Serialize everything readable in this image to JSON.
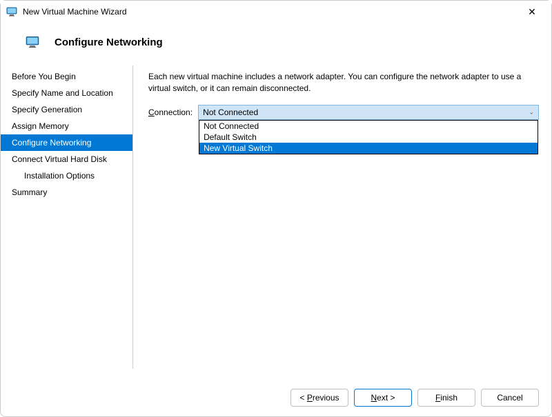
{
  "window": {
    "title": "New Virtual Machine Wizard",
    "close_glyph": "✕"
  },
  "header": {
    "title": "Configure Networking"
  },
  "sidebar": {
    "items": [
      {
        "label": "Before You Begin",
        "selected": false,
        "indent": false
      },
      {
        "label": "Specify Name and Location",
        "selected": false,
        "indent": false
      },
      {
        "label": "Specify Generation",
        "selected": false,
        "indent": false
      },
      {
        "label": "Assign Memory",
        "selected": false,
        "indent": false
      },
      {
        "label": "Configure Networking",
        "selected": true,
        "indent": false
      },
      {
        "label": "Connect Virtual Hard Disk",
        "selected": false,
        "indent": false
      },
      {
        "label": "Installation Options",
        "selected": false,
        "indent": true
      },
      {
        "label": "Summary",
        "selected": false,
        "indent": false
      }
    ]
  },
  "main": {
    "description": "Each new virtual machine includes a network adapter. You can configure the network adapter to use a virtual switch, or it can remain disconnected.",
    "connection_label_prefix_underlined": "C",
    "connection_label_rest": "onnection:",
    "selected_value": "Not Connected",
    "options": [
      {
        "label": "Not Connected",
        "highlighted": false
      },
      {
        "label": "Default Switch",
        "highlighted": false
      },
      {
        "label": "New Virtual Switch",
        "highlighted": true
      }
    ]
  },
  "footer": {
    "previous_prefix": "< ",
    "previous_u": "P",
    "previous_rest": "revious",
    "next_u": "N",
    "next_rest": "ext >",
    "finish_u": "F",
    "finish_rest": "inish",
    "cancel": "Cancel"
  }
}
